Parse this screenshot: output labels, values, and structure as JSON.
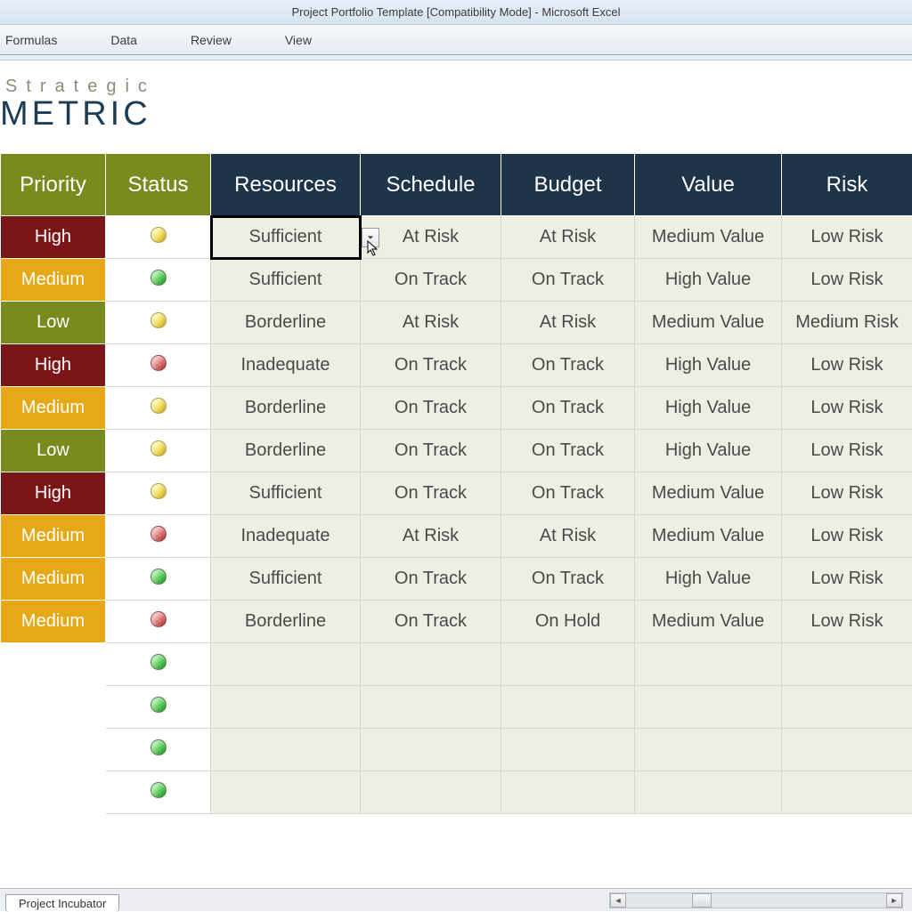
{
  "window": {
    "title": "Project Portfolio Template  [Compatibility Mode]  -  Microsoft Excel"
  },
  "menu": {
    "items": [
      "Formulas",
      "Data",
      "Review",
      "View"
    ]
  },
  "logo": {
    "line1": "Strategic",
    "line2": "METRIC"
  },
  "table": {
    "headers": {
      "priority": "Priority",
      "status": "Status",
      "resources": "Resources",
      "schedule": "Schedule",
      "budget": "Budget",
      "value": "Value",
      "risk": "Risk"
    },
    "rows": [
      {
        "priority": "High",
        "priority_class": "p-high",
        "status_color": "yellow",
        "resources": "Sufficient",
        "schedule": "At Risk",
        "budget": "At Risk",
        "value": "Medium Value",
        "risk": "Low Risk"
      },
      {
        "priority": "Medium",
        "priority_class": "p-medium",
        "status_color": "green",
        "resources": "Sufficient",
        "schedule": "On Track",
        "budget": "On Track",
        "value": "High Value",
        "risk": "Low Risk"
      },
      {
        "priority": "Low",
        "priority_class": "p-low",
        "status_color": "yellow",
        "resources": "Borderline",
        "schedule": "At Risk",
        "budget": "At Risk",
        "value": "Medium Value",
        "risk": "Medium Risk"
      },
      {
        "priority": "High",
        "priority_class": "p-high",
        "status_color": "red",
        "resources": "Inadequate",
        "schedule": "On Track",
        "budget": "On Track",
        "value": "High Value",
        "risk": "Low Risk"
      },
      {
        "priority": "Medium",
        "priority_class": "p-medium",
        "status_color": "yellow",
        "resources": "Borderline",
        "schedule": "On Track",
        "budget": "On Track",
        "value": "High Value",
        "risk": "Low Risk"
      },
      {
        "priority": "Low",
        "priority_class": "p-low",
        "status_color": "yellow",
        "resources": "Borderline",
        "schedule": "On Track",
        "budget": "On Track",
        "value": "High Value",
        "risk": "Low Risk"
      },
      {
        "priority": "High",
        "priority_class": "p-high",
        "status_color": "yellow",
        "resources": "Sufficient",
        "schedule": "On Track",
        "budget": "On Track",
        "value": "Medium Value",
        "risk": "Low Risk"
      },
      {
        "priority": "Medium",
        "priority_class": "p-medium",
        "status_color": "red",
        "resources": "Inadequate",
        "schedule": "At Risk",
        "budget": "At Risk",
        "value": "Medium Value",
        "risk": "Low Risk"
      },
      {
        "priority": "Medium",
        "priority_class": "p-medium",
        "status_color": "green",
        "resources": "Sufficient",
        "schedule": "On Track",
        "budget": "On Track",
        "value": "High Value",
        "risk": "Low Risk"
      },
      {
        "priority": "Medium",
        "priority_class": "p-medium",
        "status_color": "red",
        "resources": "Borderline",
        "schedule": "On Track",
        "budget": "On Hold",
        "value": "Medium Value",
        "risk": "Low Risk"
      },
      {
        "priority": "",
        "priority_class": "p-empty",
        "status_color": "green",
        "resources": "",
        "schedule": "",
        "budget": "",
        "value": "",
        "risk": ""
      },
      {
        "priority": "",
        "priority_class": "p-empty",
        "status_color": "green",
        "resources": "",
        "schedule": "",
        "budget": "",
        "value": "",
        "risk": ""
      },
      {
        "priority": "",
        "priority_class": "p-empty",
        "status_color": "green",
        "resources": "",
        "schedule": "",
        "budget": "",
        "value": "",
        "risk": ""
      },
      {
        "priority": "",
        "priority_class": "p-empty",
        "status_color": "green",
        "resources": "",
        "schedule": "",
        "budget": "",
        "value": "",
        "risk": ""
      }
    ]
  },
  "selected_cell": {
    "row": 0,
    "col": "resources"
  },
  "sheet": {
    "active_tab": "Project Incubator"
  }
}
